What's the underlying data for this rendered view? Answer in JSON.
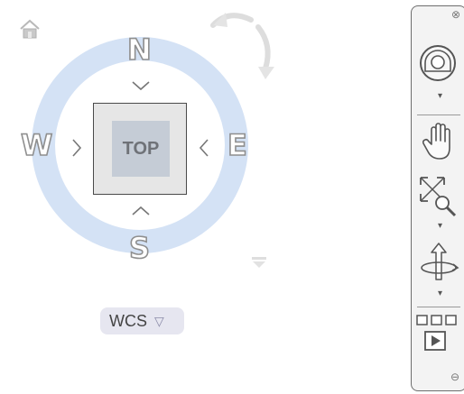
{
  "viewcube": {
    "face_label": "TOP",
    "compass": {
      "north": "N",
      "south": "S",
      "east": "E",
      "west": "W"
    },
    "ring_color": "#d4e2f5",
    "face_color": "#c5ccd6"
  },
  "ucs_menu": {
    "label": "WCS",
    "caret": "▽"
  },
  "navigation_bar": {
    "tools": [
      "steering-wheel",
      "pan",
      "zoom-extents",
      "orbit",
      "showmotion"
    ],
    "close_glyph": "⊗",
    "options_glyph": "⊖"
  }
}
